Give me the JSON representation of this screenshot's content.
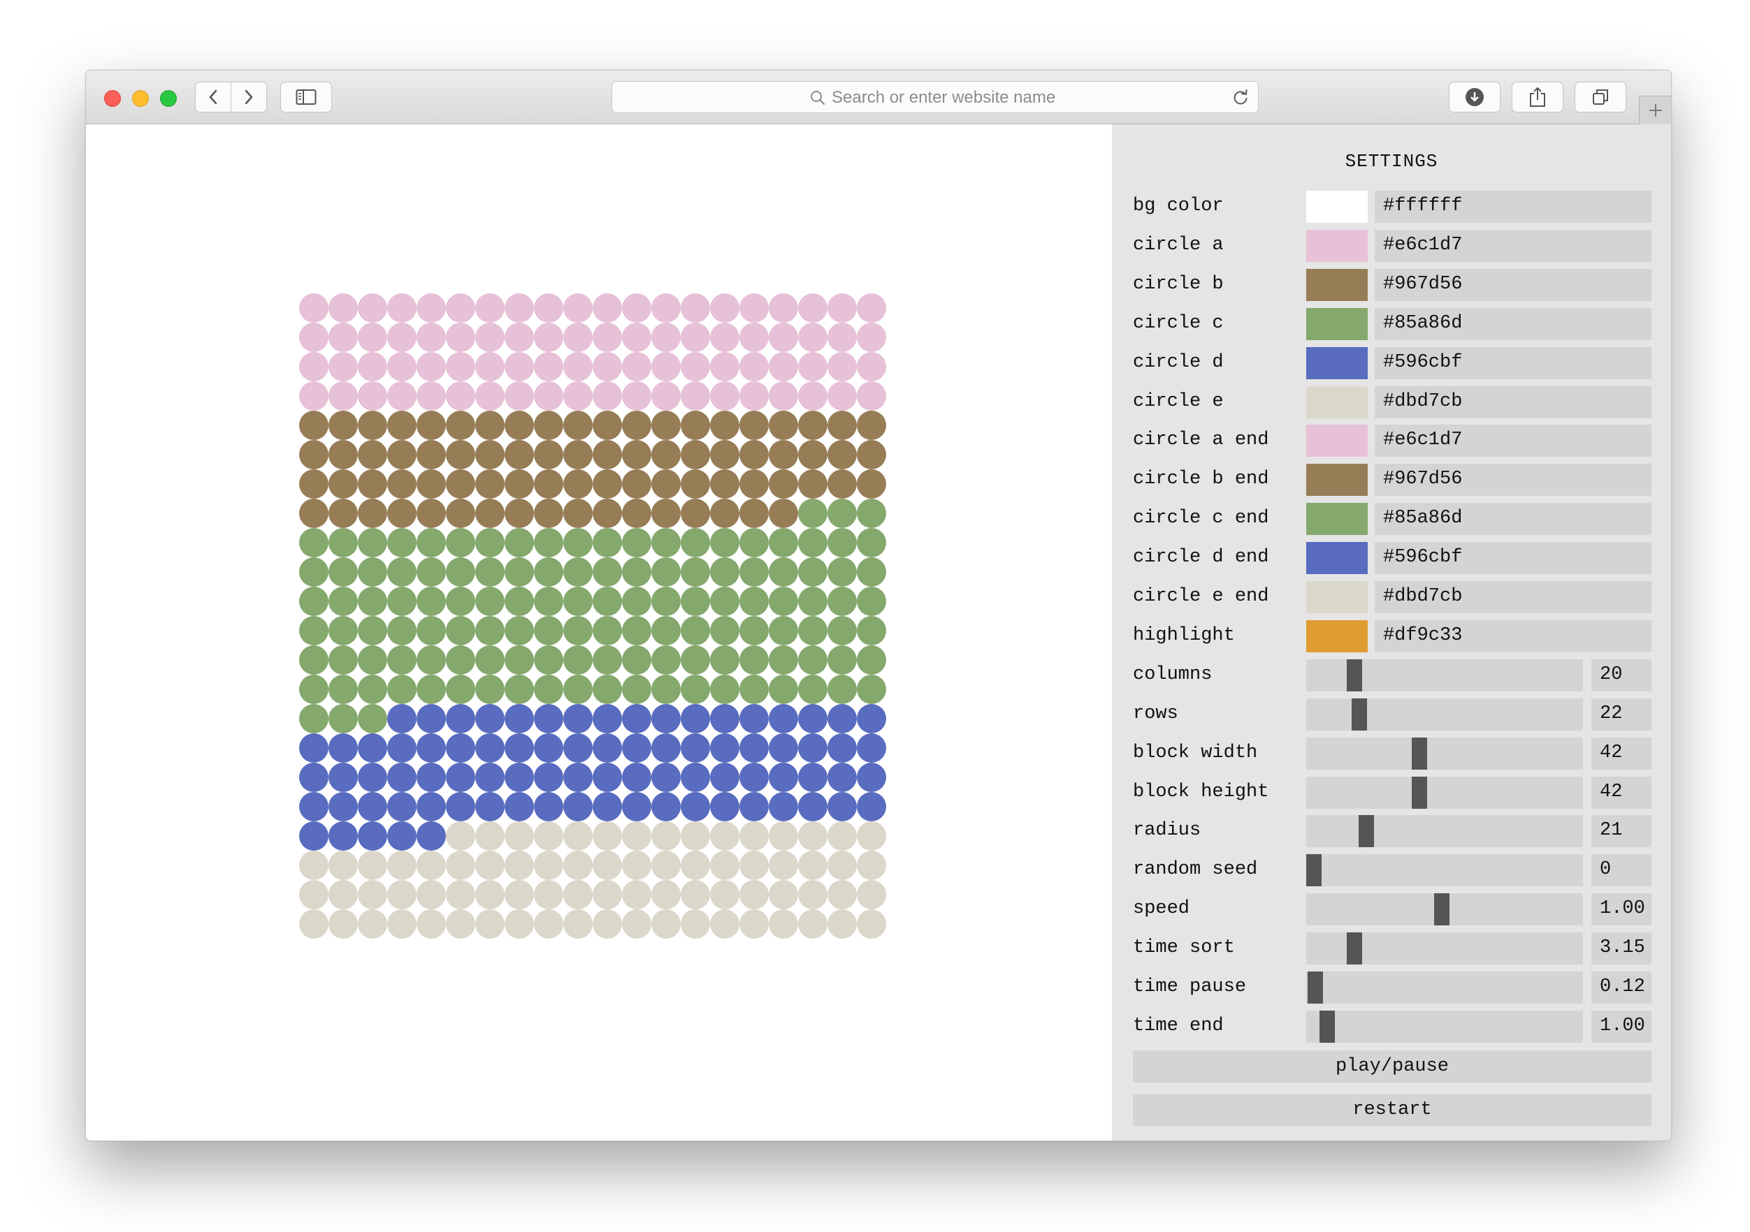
{
  "browser": {
    "address_placeholder": "Search or enter website name"
  },
  "grid": {
    "columns": 20,
    "rows": 22,
    "counts": {
      "a": 80,
      "b": 77,
      "c": 126,
      "d": 82,
      "e": 75
    },
    "colors": {
      "a": "#e6c1d7",
      "b": "#967d56",
      "c": "#85a86d",
      "d": "#596cbf",
      "e": "#dbd7cb"
    }
  },
  "settings": {
    "title": "SETTINGS",
    "colors": [
      {
        "label": "bg color",
        "value": "#ffffff"
      },
      {
        "label": "circle a",
        "value": "#e6c1d7"
      },
      {
        "label": "circle b",
        "value": "#967d56"
      },
      {
        "label": "circle c",
        "value": "#85a86d"
      },
      {
        "label": "circle d",
        "value": "#596cbf"
      },
      {
        "label": "circle e",
        "value": "#dbd7cb"
      },
      {
        "label": "circle a end",
        "value": "#e6c1d7"
      },
      {
        "label": "circle b end",
        "value": "#967d56"
      },
      {
        "label": "circle c end",
        "value": "#85a86d"
      },
      {
        "label": "circle d end",
        "value": "#596cbf"
      },
      {
        "label": "circle e end",
        "value": "#dbd7cb"
      },
      {
        "label": "highlight",
        "value": "#df9c33"
      }
    ],
    "sliders": [
      {
        "label": "columns",
        "display": "20",
        "fraction": 0.155
      },
      {
        "label": "rows",
        "display": "22",
        "fraction": 0.175
      },
      {
        "label": "block width",
        "display": "42",
        "fraction": 0.405
      },
      {
        "label": "block height",
        "display": "42",
        "fraction": 0.405
      },
      {
        "label": "radius",
        "display": "21",
        "fraction": 0.2
      },
      {
        "label": "random seed",
        "display": "0",
        "fraction": 0.0
      },
      {
        "label": "speed",
        "display": "1.00",
        "fraction": 0.49
      },
      {
        "label": "time sort",
        "display": "3.15",
        "fraction": 0.155
      },
      {
        "label": "time pause",
        "display": "0.12",
        "fraction": 0.005
      },
      {
        "label": "time end",
        "display": "1.00",
        "fraction": 0.05
      }
    ],
    "buttons": {
      "play_pause": "play/pause",
      "restart": "restart"
    }
  }
}
